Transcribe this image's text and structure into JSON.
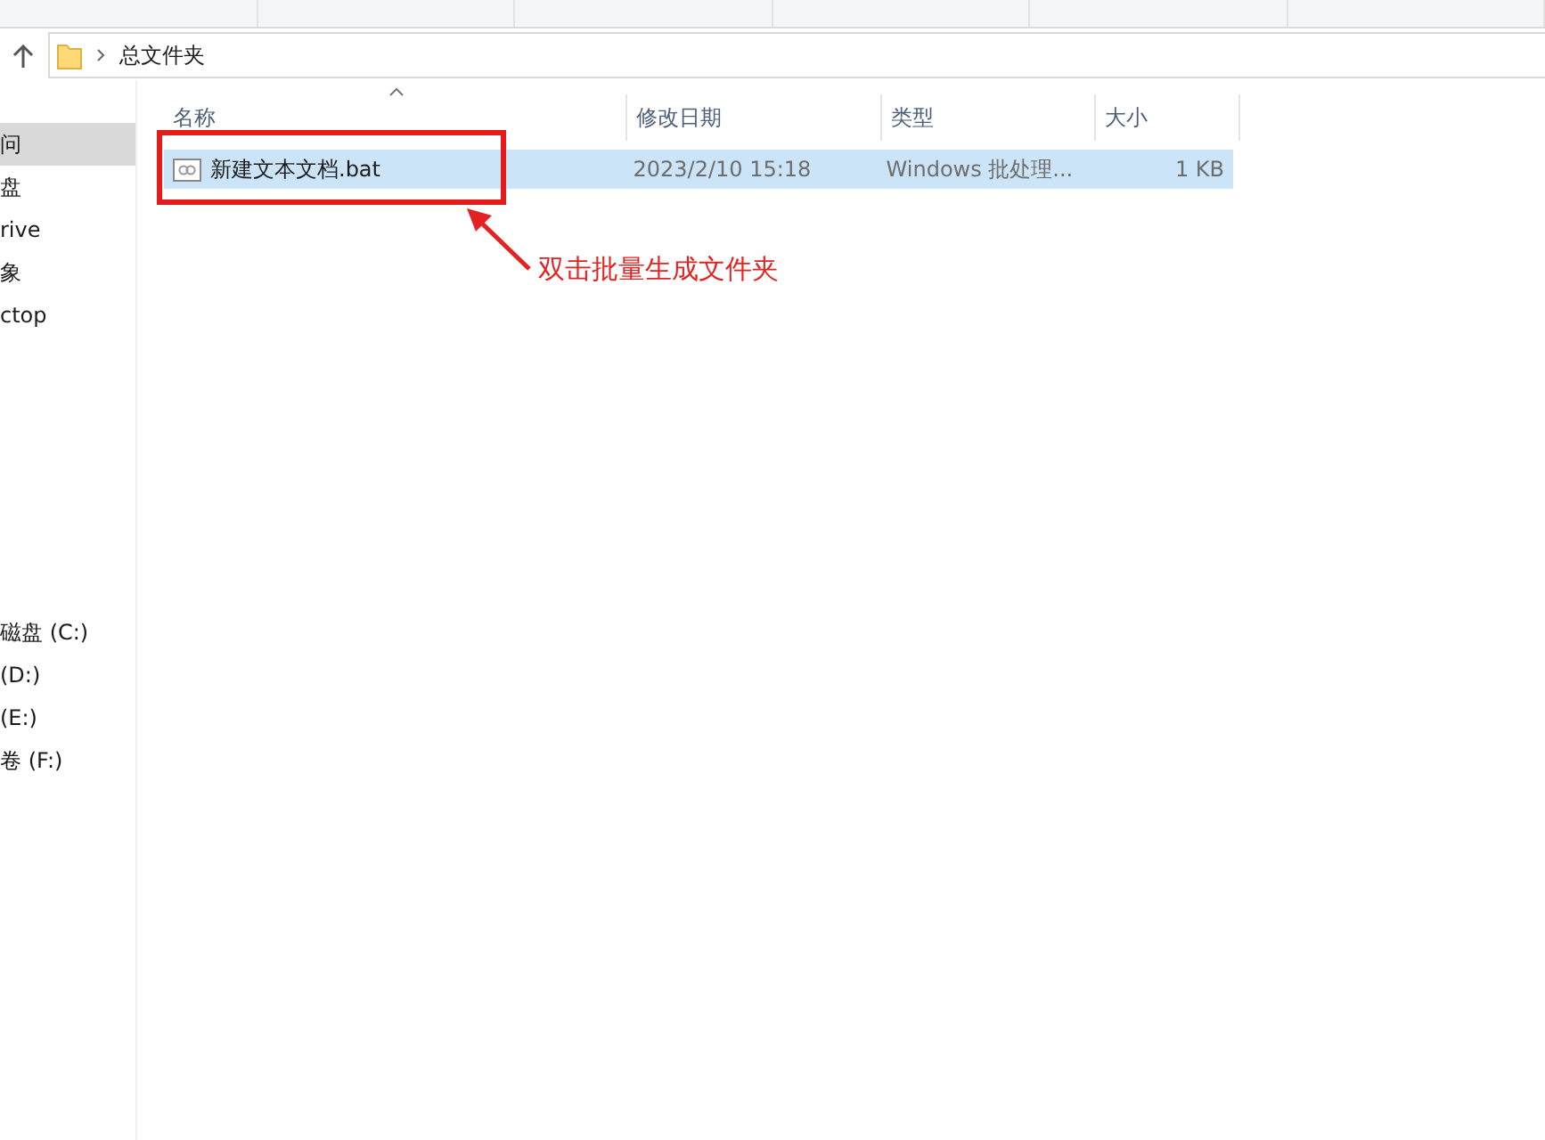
{
  "address_bar": {
    "path": "总文件夹"
  },
  "sidebar": {
    "groups": [
      [
        {
          "label": "问",
          "selected": true
        },
        {
          "label": "盘",
          "selected": false
        },
        {
          "label": "rive",
          "selected": false
        },
        {
          "label": "象",
          "selected": false
        },
        {
          "label": "ctop",
          "selected": false
        }
      ],
      [
        {
          "label": "磁盘 (C:)",
          "selected": false
        },
        {
          "label": "(D:)",
          "selected": false
        },
        {
          "label": "(E:)",
          "selected": false
        },
        {
          "label": "卷 (F:)",
          "selected": false
        }
      ]
    ]
  },
  "table": {
    "columns": [
      "名称",
      "修改日期",
      "类型",
      "大小"
    ],
    "rows": [
      {
        "cells": [
          "新建文本文档.bat",
          "2023/2/10 15:18",
          "Windows 批处理...",
          "1 KB"
        ],
        "selected": true
      }
    ]
  },
  "annotation": {
    "text": "双击批量生成文件夹"
  }
}
